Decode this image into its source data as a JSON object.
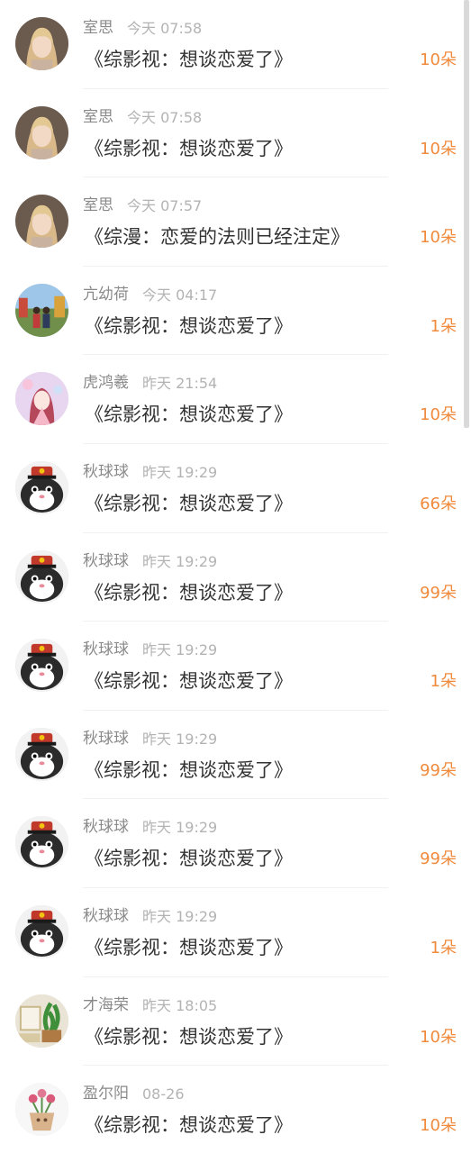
{
  "accent_color": "#f08a3c",
  "rows": [
    {
      "name": "室思",
      "time": "今天 07:58",
      "title": "《综影视：想谈恋爱了》",
      "count": "10朵",
      "avatar": "girl-blonde-avatar"
    },
    {
      "name": "室思",
      "time": "今天 07:58",
      "title": "《综影视：想谈恋爱了》",
      "count": "10朵",
      "avatar": "girl-blonde-avatar"
    },
    {
      "name": "室思",
      "time": "今天 07:57",
      "title": "《综漫：恋爱的法则已经注定》",
      "count": "10朵",
      "avatar": "girl-blonde-avatar"
    },
    {
      "name": "亢幼荷",
      "time": "今天 04:17",
      "title": "《综影视：想谈恋爱了》",
      "count": "1朵",
      "avatar": "outdoor-photo-avatar"
    },
    {
      "name": "虎鸿羲",
      "time": "昨天 21:54",
      "title": "《综影视：想谈恋爱了》",
      "count": "10朵",
      "avatar": "anime-girl-avatar"
    },
    {
      "name": "秋球球",
      "time": "昨天 19:29",
      "title": "《综影视：想谈恋爱了》",
      "count": "66朵",
      "avatar": "cat-hat-avatar"
    },
    {
      "name": "秋球球",
      "time": "昨天 19:29",
      "title": "《综影视：想谈恋爱了》",
      "count": "99朵",
      "avatar": "cat-hat-avatar"
    },
    {
      "name": "秋球球",
      "time": "昨天 19:29",
      "title": "《综影视：想谈恋爱了》",
      "count": "1朵",
      "avatar": "cat-hat-avatar"
    },
    {
      "name": "秋球球",
      "time": "昨天 19:29",
      "title": "《综影视：想谈恋爱了》",
      "count": "99朵",
      "avatar": "cat-hat-avatar"
    },
    {
      "name": "秋球球",
      "time": "昨天 19:29",
      "title": "《综影视：想谈恋爱了》",
      "count": "99朵",
      "avatar": "cat-hat-avatar"
    },
    {
      "name": "秋球球",
      "time": "昨天 19:29",
      "title": "《综影视：想谈恋爱了》",
      "count": "1朵",
      "avatar": "cat-hat-avatar"
    },
    {
      "name": "才海荣",
      "time": "昨天 18:05",
      "title": "《综影视：想谈恋爱了》",
      "count": "10朵",
      "avatar": "plant-photo-avatar"
    },
    {
      "name": "盈尔阳",
      "time": "08-26",
      "title": "《综影视：想谈恋爱了》",
      "count": "10朵",
      "avatar": "flower-pot-avatar"
    }
  ]
}
